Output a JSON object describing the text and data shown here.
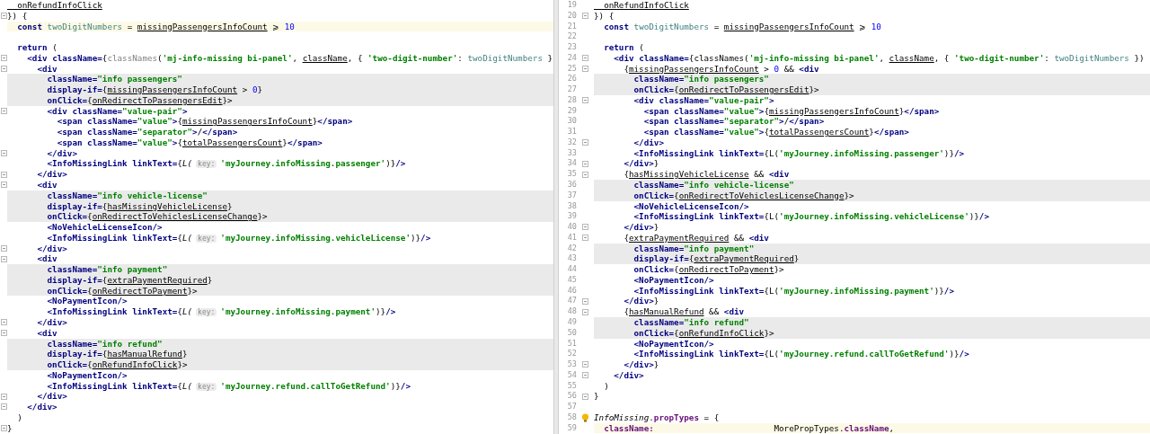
{
  "left_pane": {
    "lines": [
      {
        "tokens": [
          {
            "kind": "ref",
            "text": "  onRefundInfoClick"
          }
        ]
      },
      {
        "fold": true,
        "tokens": [
          {
            "kind": "plain",
            "text": "}) {"
          }
        ]
      },
      {
        "current": true,
        "tokens": [
          {
            "kind": "kw",
            "text": "  const "
          },
          {
            "kind": "local",
            "text": "twoDigitNumbers"
          },
          {
            "kind": "plain",
            "text": " = "
          },
          {
            "kind": "ref",
            "text": "missingPassengersInfoCount"
          },
          {
            "kind": "plain",
            "text": " ⩾ "
          },
          {
            "kind": "num",
            "text": "10"
          }
        ]
      },
      {
        "kind": "blank"
      },
      {
        "tokens": [
          {
            "kind": "kw",
            "text": "  return"
          },
          {
            "kind": "plain",
            "text": " ("
          }
        ]
      },
      {
        "fold": true,
        "tokens": [
          {
            "kind": "tag",
            "text": "    <div"
          },
          {
            "kind": "attr",
            "text": " className="
          },
          {
            "kind": "plain",
            "text": "{"
          },
          {
            "kind": "dim",
            "text": "classNames"
          },
          {
            "kind": "plain",
            "text": "("
          },
          {
            "kind": "str",
            "text": "'mj-info-missing bi-panel'"
          },
          {
            "kind": "plain",
            "text": ", "
          },
          {
            "kind": "ref",
            "text": "className"
          },
          {
            "kind": "plain",
            "text": ", { "
          },
          {
            "kind": "str",
            "text": "'two-digit-number'"
          },
          {
            "kind": "plain",
            "text": ": "
          },
          {
            "kind": "local",
            "text": "twoDigitNumbers"
          },
          {
            "kind": "plain",
            "text": " }"
          }
        ]
      },
      {
        "fold": true,
        "tokens": [
          {
            "kind": "tag",
            "text": "      <div"
          }
        ]
      },
      {
        "changed": true,
        "tokens": [
          {
            "kind": "attr",
            "text": "        className="
          },
          {
            "kind": "str",
            "text": "\"info passengers\""
          }
        ]
      },
      {
        "changed": true,
        "tokens": [
          {
            "kind": "attr",
            "text": "        display-if="
          },
          {
            "kind": "plain",
            "text": "{"
          },
          {
            "kind": "ref",
            "text": "missingPassengersInfoCount"
          },
          {
            "kind": "plain",
            "text": " > "
          },
          {
            "kind": "num",
            "text": "0"
          },
          {
            "kind": "plain",
            "text": "}"
          }
        ]
      },
      {
        "changed": true,
        "tokens": [
          {
            "kind": "attr",
            "text": "        onClick="
          },
          {
            "kind": "plain",
            "text": "{"
          },
          {
            "kind": "ref",
            "text": "onRedirectToPassengersEdit"
          },
          {
            "kind": "plain",
            "text": "}>"
          }
        ]
      },
      {
        "fold": true,
        "tokens": [
          {
            "kind": "tag",
            "text": "        <div"
          },
          {
            "kind": "attr",
            "text": " className="
          },
          {
            "kind": "str",
            "text": "\"value-pair\""
          },
          {
            "kind": "tag",
            "text": ">"
          }
        ]
      },
      {
        "tokens": [
          {
            "kind": "tag",
            "text": "          <span"
          },
          {
            "kind": "attr",
            "text": " className="
          },
          {
            "kind": "str",
            "text": "\"value\""
          },
          {
            "kind": "tag",
            "text": ">"
          },
          {
            "kind": "plain",
            "text": "{"
          },
          {
            "kind": "ref",
            "text": "missingPassengersInfoCount"
          },
          {
            "kind": "plain",
            "text": "}"
          },
          {
            "kind": "tag",
            "text": "</span>"
          }
        ]
      },
      {
        "tokens": [
          {
            "kind": "tag",
            "text": "          <span"
          },
          {
            "kind": "attr",
            "text": " className="
          },
          {
            "kind": "str",
            "text": "\"separator\""
          },
          {
            "kind": "tag",
            "text": ">"
          },
          {
            "kind": "plain",
            "text": "/"
          },
          {
            "kind": "tag",
            "text": "</span>"
          }
        ]
      },
      {
        "tokens": [
          {
            "kind": "tag",
            "text": "          <span"
          },
          {
            "kind": "attr",
            "text": " className="
          },
          {
            "kind": "str",
            "text": "\"value\""
          },
          {
            "kind": "tag",
            "text": ">"
          },
          {
            "kind": "plain",
            "text": "{"
          },
          {
            "kind": "ref",
            "text": "totalPassengersCount"
          },
          {
            "kind": "plain",
            "text": "}"
          },
          {
            "kind": "tag",
            "text": "</span>"
          }
        ]
      },
      {
        "fold": true,
        "tokens": [
          {
            "kind": "tag",
            "text": "        </div>"
          }
        ]
      },
      {
        "tokens": [
          {
            "kind": "tag",
            "text": "        <InfoMissingLink"
          },
          {
            "kind": "attr",
            "text": " linkText="
          },
          {
            "kind": "plain",
            "text": "{"
          },
          {
            "kind": "call",
            "text": "L("
          },
          {
            "kind": "hint",
            "text": "key:"
          },
          {
            "kind": "str",
            "text": "'myJourney.infoMissing.passenger'"
          },
          {
            "kind": "plain",
            "text": ")}"
          },
          {
            "kind": "tag",
            "text": "/>"
          }
        ]
      },
      {
        "fold": true,
        "tokens": [
          {
            "kind": "tag",
            "text": "      </div>"
          }
        ]
      },
      {
        "fold": true,
        "tokens": [
          {
            "kind": "tag",
            "text": "      <div"
          }
        ]
      },
      {
        "changed": true,
        "tokens": [
          {
            "kind": "attr",
            "text": "        className="
          },
          {
            "kind": "str",
            "text": "\"info vehicle-license\""
          }
        ]
      },
      {
        "changed": true,
        "tokens": [
          {
            "kind": "attr",
            "text": "        display-if="
          },
          {
            "kind": "plain",
            "text": "{"
          },
          {
            "kind": "ref",
            "text": "hasMissingVehicleLicense"
          },
          {
            "kind": "plain",
            "text": "}"
          }
        ]
      },
      {
        "changed": true,
        "tokens": [
          {
            "kind": "attr",
            "text": "        onClick="
          },
          {
            "kind": "plain",
            "text": "{"
          },
          {
            "kind": "ref",
            "text": "onRedirectToVehiclesLicenseChange"
          },
          {
            "kind": "plain",
            "text": "}>"
          }
        ]
      },
      {
        "tokens": [
          {
            "kind": "tag",
            "text": "        <NoVehicleLicenseIcon/>"
          }
        ]
      },
      {
        "tokens": [
          {
            "kind": "tag",
            "text": "        <InfoMissingLink"
          },
          {
            "kind": "attr",
            "text": " linkText="
          },
          {
            "kind": "plain",
            "text": "{"
          },
          {
            "kind": "call",
            "text": "L("
          },
          {
            "kind": "hint",
            "text": "key:"
          },
          {
            "kind": "str",
            "text": "'myJourney.infoMissing.vehicleLicense'"
          },
          {
            "kind": "plain",
            "text": ")}"
          },
          {
            "kind": "tag",
            "text": "/>"
          }
        ]
      },
      {
        "fold": true,
        "tokens": [
          {
            "kind": "tag",
            "text": "      </div>"
          }
        ]
      },
      {
        "fold": true,
        "tokens": [
          {
            "kind": "tag",
            "text": "      <div"
          }
        ]
      },
      {
        "changed": true,
        "tokens": [
          {
            "kind": "attr",
            "text": "        className="
          },
          {
            "kind": "str",
            "text": "\"info payment\""
          }
        ]
      },
      {
        "changed": true,
        "tokens": [
          {
            "kind": "attr",
            "text": "        display-if="
          },
          {
            "kind": "plain",
            "text": "{"
          },
          {
            "kind": "ref",
            "text": "extraPaymentRequired"
          },
          {
            "kind": "plain",
            "text": "}"
          }
        ]
      },
      {
        "changed": true,
        "tokens": [
          {
            "kind": "attr",
            "text": "        onClick="
          },
          {
            "kind": "plain",
            "text": "{"
          },
          {
            "kind": "ref",
            "text": "onRedirectToPayment"
          },
          {
            "kind": "plain",
            "text": "}>"
          }
        ]
      },
      {
        "tokens": [
          {
            "kind": "tag",
            "text": "        <NoPaymentIcon/>"
          }
        ]
      },
      {
        "tokens": [
          {
            "kind": "tag",
            "text": "        <InfoMissingLink"
          },
          {
            "kind": "attr",
            "text": " linkText="
          },
          {
            "kind": "plain",
            "text": "{"
          },
          {
            "kind": "call",
            "text": "L("
          },
          {
            "kind": "hint",
            "text": "key:"
          },
          {
            "kind": "str",
            "text": "'myJourney.infoMissing.payment'"
          },
          {
            "kind": "plain",
            "text": ")}"
          },
          {
            "kind": "tag",
            "text": "/>"
          }
        ]
      },
      {
        "fold": true,
        "tokens": [
          {
            "kind": "tag",
            "text": "      </div>"
          }
        ]
      },
      {
        "fold": true,
        "tokens": [
          {
            "kind": "tag",
            "text": "      <div"
          }
        ]
      },
      {
        "changed": true,
        "tokens": [
          {
            "kind": "attr",
            "text": "        className="
          },
          {
            "kind": "str",
            "text": "\"info refund\""
          }
        ]
      },
      {
        "changed": true,
        "tokens": [
          {
            "kind": "attr",
            "text": "        display-if="
          },
          {
            "kind": "plain",
            "text": "{"
          },
          {
            "kind": "ref",
            "text": "hasManualRefund"
          },
          {
            "kind": "plain",
            "text": "}"
          }
        ]
      },
      {
        "changed": true,
        "tokens": [
          {
            "kind": "attr",
            "text": "        onClick="
          },
          {
            "kind": "plain",
            "text": "{"
          },
          {
            "kind": "ref",
            "text": "onRefundInfoClick"
          },
          {
            "kind": "plain",
            "text": "}>"
          }
        ]
      },
      {
        "tokens": [
          {
            "kind": "tag",
            "text": "        <NoPaymentIcon/>"
          }
        ]
      },
      {
        "tokens": [
          {
            "kind": "tag",
            "text": "        <InfoMissingLink"
          },
          {
            "kind": "attr",
            "text": " linkText="
          },
          {
            "kind": "plain",
            "text": "{"
          },
          {
            "kind": "call",
            "text": "L("
          },
          {
            "kind": "hint",
            "text": "key:"
          },
          {
            "kind": "str",
            "text": "'myJourney.refund.callToGetRefund'"
          },
          {
            "kind": "plain",
            "text": ")}"
          },
          {
            "kind": "tag",
            "text": "/>"
          }
        ]
      },
      {
        "fold": true,
        "tokens": [
          {
            "kind": "tag",
            "text": "      </div>"
          }
        ]
      },
      {
        "fold": true,
        "tokens": [
          {
            "kind": "tag",
            "text": "    </div>"
          }
        ]
      },
      {
        "tokens": [
          {
            "kind": "plain",
            "text": "  )"
          }
        ]
      },
      {
        "fold": true,
        "tokens": [
          {
            "kind": "plain",
            "text": "}"
          }
        ]
      }
    ]
  },
  "right_pane": {
    "lines": [
      {
        "number": "19",
        "tokens": [
          {
            "kind": "ref",
            "text": "  onRefundInfoClick"
          }
        ]
      },
      {
        "number": "20",
        "fold": true,
        "tokens": [
          {
            "kind": "plain",
            "text": "}) {"
          }
        ]
      },
      {
        "number": "21",
        "tokens": [
          {
            "kind": "kw",
            "text": "  const "
          },
          {
            "kind": "local",
            "text": "twoDigitNumbers"
          },
          {
            "kind": "plain",
            "text": " = "
          },
          {
            "kind": "ref",
            "text": "missingPassengersInfoCount"
          },
          {
            "kind": "plain",
            "text": " ⩾ "
          },
          {
            "kind": "num",
            "text": "10"
          }
        ]
      },
      {
        "number": "22"
      },
      {
        "number": "23",
        "tokens": [
          {
            "kind": "kw",
            "text": "  return"
          },
          {
            "kind": "plain",
            "text": " ("
          }
        ]
      },
      {
        "number": "24",
        "fold": true,
        "tokens": [
          {
            "kind": "tag",
            "text": "    <div"
          },
          {
            "kind": "attr",
            "text": " className="
          },
          {
            "kind": "plain",
            "text": "{classNames("
          },
          {
            "kind": "str",
            "text": "'mj-info-missing bi-panel'"
          },
          {
            "kind": "plain",
            "text": ", "
          },
          {
            "kind": "ref",
            "text": "className"
          },
          {
            "kind": "plain",
            "text": ", { "
          },
          {
            "kind": "str",
            "text": "'two-digit-number'"
          },
          {
            "kind": "plain",
            "text": ": "
          },
          {
            "kind": "local",
            "text": "twoDigitNumbers"
          },
          {
            "kind": "plain",
            "text": " })"
          }
        ]
      },
      {
        "number": "25",
        "fold": true,
        "tokens": [
          {
            "kind": "plain",
            "text": "      {"
          },
          {
            "kind": "ref",
            "text": "missingPassengersInfoCount"
          },
          {
            "kind": "plain",
            "text": " > "
          },
          {
            "kind": "num",
            "text": "0"
          },
          {
            "kind": "plain",
            "text": " && "
          },
          {
            "kind": "tag",
            "text": "<div"
          }
        ]
      },
      {
        "number": "26",
        "changed": true,
        "tokens": [
          {
            "kind": "attr",
            "text": "        className="
          },
          {
            "kind": "str",
            "text": "\"info passengers\""
          }
        ]
      },
      {
        "number": "27",
        "changed": true,
        "tokens": [
          {
            "kind": "attr",
            "text": "        onClick="
          },
          {
            "kind": "plain",
            "text": "{"
          },
          {
            "kind": "ref",
            "text": "onRedirectToPassengersEdit"
          },
          {
            "kind": "plain",
            "text": "}>"
          }
        ]
      },
      {
        "number": "28",
        "fold": true,
        "tokens": [
          {
            "kind": "tag",
            "text": "        <div"
          },
          {
            "kind": "attr",
            "text": " className="
          },
          {
            "kind": "str",
            "text": "\"value-pair\""
          },
          {
            "kind": "tag",
            "text": ">"
          }
        ]
      },
      {
        "number": "29",
        "tokens": [
          {
            "kind": "tag",
            "text": "          <span"
          },
          {
            "kind": "attr",
            "text": " className="
          },
          {
            "kind": "str",
            "text": "\"value\""
          },
          {
            "kind": "tag",
            "text": ">"
          },
          {
            "kind": "plain",
            "text": "{"
          },
          {
            "kind": "ref",
            "text": "missingPassengersInfoCount"
          },
          {
            "kind": "plain",
            "text": "}"
          },
          {
            "kind": "tag",
            "text": "</span>"
          }
        ]
      },
      {
        "number": "30",
        "tokens": [
          {
            "kind": "tag",
            "text": "          <span"
          },
          {
            "kind": "attr",
            "text": " className="
          },
          {
            "kind": "str",
            "text": "\"separator\""
          },
          {
            "kind": "tag",
            "text": ">"
          },
          {
            "kind": "plain",
            "text": "/"
          },
          {
            "kind": "tag",
            "text": "</span>"
          }
        ]
      },
      {
        "number": "31",
        "tokens": [
          {
            "kind": "tag",
            "text": "          <span"
          },
          {
            "kind": "attr",
            "text": " className="
          },
          {
            "kind": "str",
            "text": "\"value\""
          },
          {
            "kind": "tag",
            "text": ">"
          },
          {
            "kind": "plain",
            "text": "{"
          },
          {
            "kind": "ref",
            "text": "totalPassengersCount"
          },
          {
            "kind": "plain",
            "text": "}"
          },
          {
            "kind": "tag",
            "text": "</span>"
          }
        ]
      },
      {
        "number": "32",
        "fold": true,
        "tokens": [
          {
            "kind": "tag",
            "text": "        </div>"
          }
        ]
      },
      {
        "number": "33",
        "tokens": [
          {
            "kind": "tag",
            "text": "        <InfoMissingLink"
          },
          {
            "kind": "attr",
            "text": " linkText="
          },
          {
            "kind": "plain",
            "text": "{L("
          },
          {
            "kind": "str",
            "text": "'myJourney.infoMissing.passenger'"
          },
          {
            "kind": "plain",
            "text": ")}"
          },
          {
            "kind": "tag",
            "text": "/>"
          }
        ]
      },
      {
        "number": "34",
        "fold": true,
        "tokens": [
          {
            "kind": "tag",
            "text": "      </div>"
          },
          {
            "kind": "plain",
            "text": "}"
          }
        ]
      },
      {
        "number": "35",
        "fold": true,
        "tokens": [
          {
            "kind": "plain",
            "text": "      {"
          },
          {
            "kind": "ref",
            "text": "hasMissingVehicleLicense"
          },
          {
            "kind": "plain",
            "text": " && "
          },
          {
            "kind": "tag",
            "text": "<div"
          }
        ]
      },
      {
        "number": "36",
        "changed": true,
        "tokens": [
          {
            "kind": "attr",
            "text": "        className="
          },
          {
            "kind": "str",
            "text": "\"info vehicle-license\""
          }
        ]
      },
      {
        "number": "37",
        "changed": true,
        "tokens": [
          {
            "kind": "attr",
            "text": "        onClick="
          },
          {
            "kind": "plain",
            "text": "{"
          },
          {
            "kind": "ref",
            "text": "onRedirectToVehiclesLicenseChange"
          },
          {
            "kind": "plain",
            "text": "}>"
          }
        ]
      },
      {
        "number": "38",
        "tokens": [
          {
            "kind": "tag",
            "text": "        <NoVehicleLicenseIcon/>"
          }
        ]
      },
      {
        "number": "39",
        "tokens": [
          {
            "kind": "tag",
            "text": "        <InfoMissingLink"
          },
          {
            "kind": "attr",
            "text": " linkText="
          },
          {
            "kind": "plain",
            "text": "{L("
          },
          {
            "kind": "str",
            "text": "'myJourney.infoMissing.vehicleLicense'"
          },
          {
            "kind": "plain",
            "text": ")}"
          },
          {
            "kind": "tag",
            "text": "/>"
          }
        ]
      },
      {
        "number": "40",
        "fold": true,
        "tokens": [
          {
            "kind": "tag",
            "text": "      </div>"
          },
          {
            "kind": "plain",
            "text": "}"
          }
        ]
      },
      {
        "number": "41",
        "fold": true,
        "tokens": [
          {
            "kind": "plain",
            "text": "      {"
          },
          {
            "kind": "ref",
            "text": "extraPaymentRequired"
          },
          {
            "kind": "plain",
            "text": " && "
          },
          {
            "kind": "tag",
            "text": "<div"
          }
        ]
      },
      {
        "number": "42",
        "changed": true,
        "tokens": [
          {
            "kind": "attr",
            "text": "        className="
          },
          {
            "kind": "str",
            "text": "\"info payment\""
          }
        ]
      },
      {
        "number": "43",
        "changed": true,
        "tokens": [
          {
            "kind": "attr",
            "text": "        display-if="
          },
          {
            "kind": "plain",
            "text": "{"
          },
          {
            "kind": "ref",
            "text": "extraPaymentRequired"
          },
          {
            "kind": "plain",
            "text": "}"
          }
        ]
      },
      {
        "number": "44",
        "tokens": [
          {
            "kind": "attr",
            "text": "        onClick="
          },
          {
            "kind": "plain",
            "text": "{"
          },
          {
            "kind": "ref",
            "text": "onRedirectToPayment"
          },
          {
            "kind": "plain",
            "text": "}>"
          }
        ]
      },
      {
        "number": "45",
        "tokens": [
          {
            "kind": "tag",
            "text": "        <NoPaymentIcon/>"
          }
        ]
      },
      {
        "number": "46",
        "tokens": [
          {
            "kind": "tag",
            "text": "        <InfoMissingLink"
          },
          {
            "kind": "attr",
            "text": " linkText="
          },
          {
            "kind": "plain",
            "text": "{L("
          },
          {
            "kind": "str",
            "text": "'myJourney.infoMissing.payment'"
          },
          {
            "kind": "plain",
            "text": ")}"
          },
          {
            "kind": "tag",
            "text": "/>"
          }
        ]
      },
      {
        "number": "47",
        "fold": true,
        "tokens": [
          {
            "kind": "tag",
            "text": "      </div>"
          },
          {
            "kind": "plain",
            "text": "}"
          }
        ]
      },
      {
        "number": "48",
        "fold": true,
        "tokens": [
          {
            "kind": "plain",
            "text": "      {"
          },
          {
            "kind": "ref",
            "text": "hasManualRefund"
          },
          {
            "kind": "plain",
            "text": " && "
          },
          {
            "kind": "tag",
            "text": "<div"
          }
        ]
      },
      {
        "number": "49",
        "changed": true,
        "tokens": [
          {
            "kind": "attr",
            "text": "        className="
          },
          {
            "kind": "str",
            "text": "\"info refund\""
          }
        ]
      },
      {
        "number": "50",
        "changed": true,
        "tokens": [
          {
            "kind": "attr",
            "text": "        onClick="
          },
          {
            "kind": "plain",
            "text": "{"
          },
          {
            "kind": "ref",
            "text": "onRefundInfoClick"
          },
          {
            "kind": "plain",
            "text": "}>"
          }
        ]
      },
      {
        "number": "51",
        "tokens": [
          {
            "kind": "tag",
            "text": "        <NoPaymentIcon/>"
          }
        ]
      },
      {
        "number": "52",
        "tokens": [
          {
            "kind": "tag",
            "text": "        <InfoMissingLink"
          },
          {
            "kind": "attr",
            "text": " linkText="
          },
          {
            "kind": "plain",
            "text": "{L("
          },
          {
            "kind": "str",
            "text": "'myJourney.refund.callToGetRefund'"
          },
          {
            "kind": "plain",
            "text": ")}"
          },
          {
            "kind": "tag",
            "text": "/>"
          }
        ]
      },
      {
        "number": "53",
        "fold": true,
        "tokens": [
          {
            "kind": "tag",
            "text": "      </div>"
          },
          {
            "kind": "plain",
            "text": "}"
          }
        ]
      },
      {
        "number": "54",
        "fold": true,
        "tokens": [
          {
            "kind": "tag",
            "text": "    </div>"
          }
        ]
      },
      {
        "number": "55",
        "tokens": [
          {
            "kind": "plain",
            "text": "  )"
          }
        ]
      },
      {
        "number": "56",
        "fold": true,
        "tokens": [
          {
            "kind": "plain",
            "text": "}"
          }
        ]
      },
      {
        "number": "57"
      },
      {
        "number": "58",
        "bulb": true,
        "tokens": [
          {
            "kind": "call",
            "text": "InfoMissing"
          },
          {
            "kind": "plain",
            "text": "."
          },
          {
            "kind": "prop",
            "text": "propTypes"
          },
          {
            "kind": "plain",
            "text": " = {"
          }
        ]
      },
      {
        "number": "59",
        "current": true,
        "tokens": [
          {
            "kind": "prop",
            "text": "  className:"
          },
          {
            "kind": "plain",
            "text": "                        MorePropTypes."
          },
          {
            "kind": "prop",
            "text": "className"
          },
          {
            "kind": "plain",
            "text": ","
          }
        ]
      }
    ]
  }
}
